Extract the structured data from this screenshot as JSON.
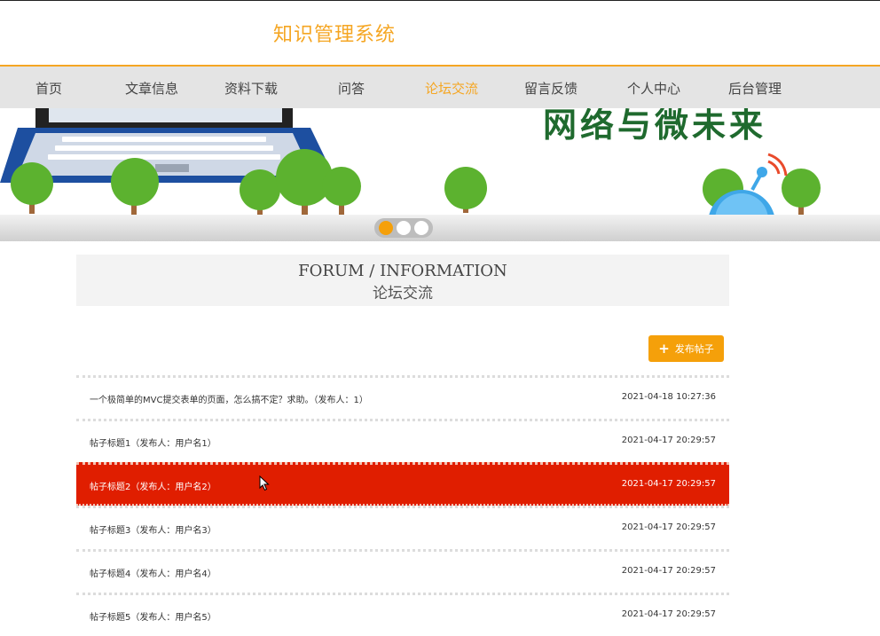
{
  "header": {
    "title": "知识管理系统"
  },
  "nav": {
    "items": [
      {
        "label": "首页"
      },
      {
        "label": "文章信息"
      },
      {
        "label": "资料下载"
      },
      {
        "label": "问答"
      },
      {
        "label": "论坛交流"
      },
      {
        "label": "留言反馈"
      },
      {
        "label": "个人中心"
      },
      {
        "label": "后台管理"
      }
    ],
    "active_index": 4
  },
  "banner": {
    "slide_text": "网络与微未来",
    "dots_count": 3,
    "active_dot": 0
  },
  "section": {
    "title_en": "FORUM / INFORMATION",
    "title_cn": "论坛交流"
  },
  "actions": {
    "post_button": "发布帖子"
  },
  "posts": [
    {
      "title": "一个极简单的MVC提交表单的页面，怎么搞不定？求助。（发布人：1）",
      "time": "2021-04-18 10:27:36"
    },
    {
      "title": "帖子标题1（发布人：用户名1）",
      "time": "2021-04-17 20:29:57"
    },
    {
      "title": "帖子标题2（发布人：用户名2）",
      "time": "2021-04-17 20:29:57"
    },
    {
      "title": "帖子标题3（发布人：用户名3）",
      "time": "2021-04-17 20:29:57"
    },
    {
      "title": "帖子标题4（发布人：用户名4）",
      "time": "2021-04-17 20:29:57"
    },
    {
      "title": "帖子标题5（发布人：用户名5）",
      "time": "2021-04-17 20:29:57"
    }
  ],
  "highlighted_post_index": 2,
  "colors": {
    "accent": "#f5a623",
    "highlight": "#e01e00",
    "nav_bg": "#e4e4e4"
  }
}
